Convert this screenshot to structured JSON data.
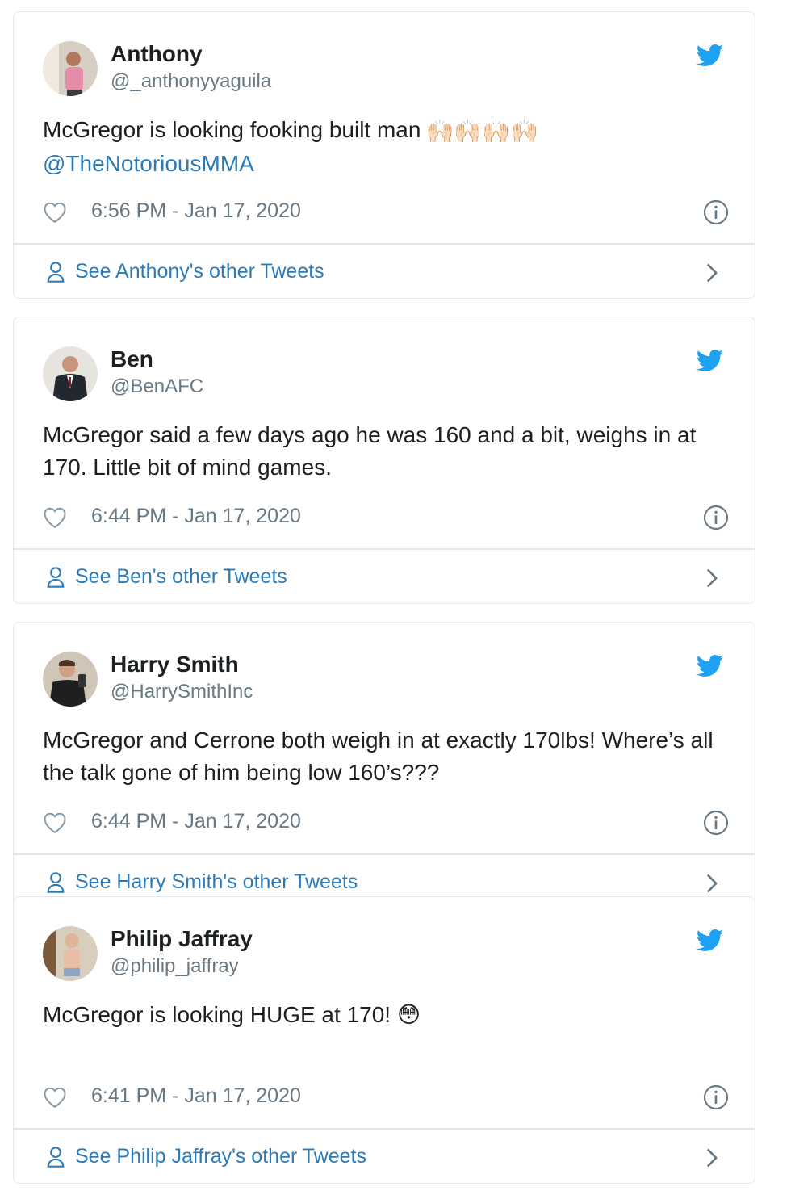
{
  "tweets": [
    {
      "name": "Anthony",
      "handle": "@_anthonyyaguila",
      "text": "McGregor is looking fooking built man",
      "mention": "@TheNotoriousMMA",
      "emoji": "🙌🏻🙌🏻🙌🏻🙌🏻",
      "time": "6:56 PM - Jan 17, 2020",
      "footer_link": "See Anthony's other Tweets"
    },
    {
      "name": "Ben",
      "handle": "@BenAFC",
      "text": "McGregor said a few days ago he was 160 and a bit, weighs in at 170. Little bit of mind games.",
      "time": "6:44 PM - Jan 17, 2020",
      "footer_link": "See Ben's other Tweets"
    },
    {
      "name": "Harry Smith",
      "handle": "@HarrySmithInc",
      "text": "McGregor and Cerrone both weigh in at exactly 170lbs! Where’s all the talk gone of him being low 160’s???",
      "time": "6:44 PM - Jan 17, 2020",
      "footer_link": "See Harry Smith's other Tweets"
    },
    {
      "name": "Philip Jaffray",
      "handle": "@philip_jaffray",
      "text": "McGregor is looking HUGE at 170!",
      "emoji": "😳",
      "time": "6:41 PM - Jan 17, 2020",
      "footer_link": "See Philip Jaffray's other Tweets"
    }
  ],
  "icons": {
    "brand": "twitter-bird-icon",
    "like": "heart-icon",
    "info": "info-icon",
    "profile": "person-icon",
    "arrow": "chevron-right-icon"
  },
  "colors": {
    "twitter_blue": "#1da1f2",
    "link_blue": "#2b7bb9",
    "secondary_text": "#697882",
    "border": "#e1e8ed"
  }
}
